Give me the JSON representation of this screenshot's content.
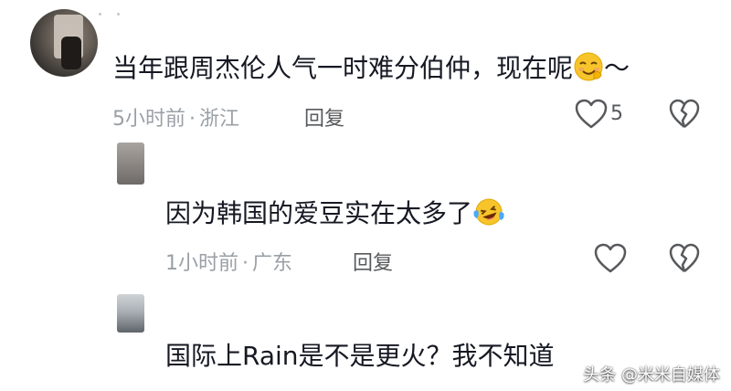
{
  "comments": [
    {
      "text": "当年跟周杰伦人气一时难分伯仲，现在呢",
      "suffix": "～",
      "time": "5小时前",
      "separator": "·",
      "location": "浙江",
      "reply_label": "回复",
      "like_count": "5",
      "emoji": "smirk-face"
    },
    {
      "text": "因为韩国的爱豆实在太多了",
      "time": "1小时前",
      "separator": "·",
      "location": "广东",
      "reply_label": "回复",
      "emoji": "laughing-tears-face"
    },
    {
      "text": "国际上Rain是不是更火？我不知道"
    }
  ],
  "watermark": "头条 @米米自媒体",
  "colors": {
    "text": "#161823",
    "meta": "#9aa0a6",
    "icon": "#57595c",
    "emoji": "#f7c52b"
  }
}
